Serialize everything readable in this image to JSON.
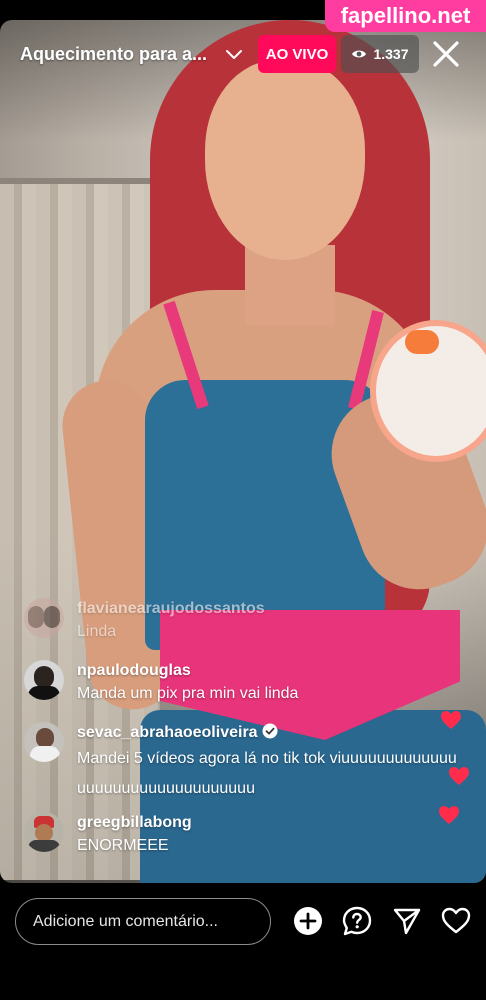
{
  "watermark": "fapellino.net",
  "header": {
    "title": "Aquecimento para a...",
    "live_label": "AO VIVO",
    "viewer_count": "1.337",
    "icons": [
      "chevron-down-icon",
      "eye-icon",
      "close-icon"
    ]
  },
  "comments": [
    {
      "username": "flavianearaujodossantos",
      "text": "Linda",
      "faded": true,
      "avatar": "avatar-flaviane"
    },
    {
      "username": "npaulodouglas",
      "text": "Manda um pix pra min  vai linda",
      "faded": false,
      "avatar": "avatar-npaulo"
    },
    {
      "username": "sevac_abrahaoeoliveira",
      "verified": true,
      "text": "Mandei 5 vídeos agora lá no tik tok viuuuuuuuuuuuuuuuuuuuuuuuuuuuuuuuuu",
      "faded": false,
      "avatar": "avatar-sevac"
    },
    {
      "username": "greegbillabong",
      "text": "ENORMEEE",
      "faded": false,
      "avatar": "avatar-greeg"
    }
  ],
  "bottom_bar": {
    "comment_placeholder": "Adicione um comentário...",
    "icons": [
      "add-circle-icon",
      "question-icon",
      "send-icon",
      "heart-icon"
    ]
  },
  "colors": {
    "live_badge": "#ff0a5a",
    "watermark": "#ff3da0",
    "heart": "#ff2d4b"
  }
}
